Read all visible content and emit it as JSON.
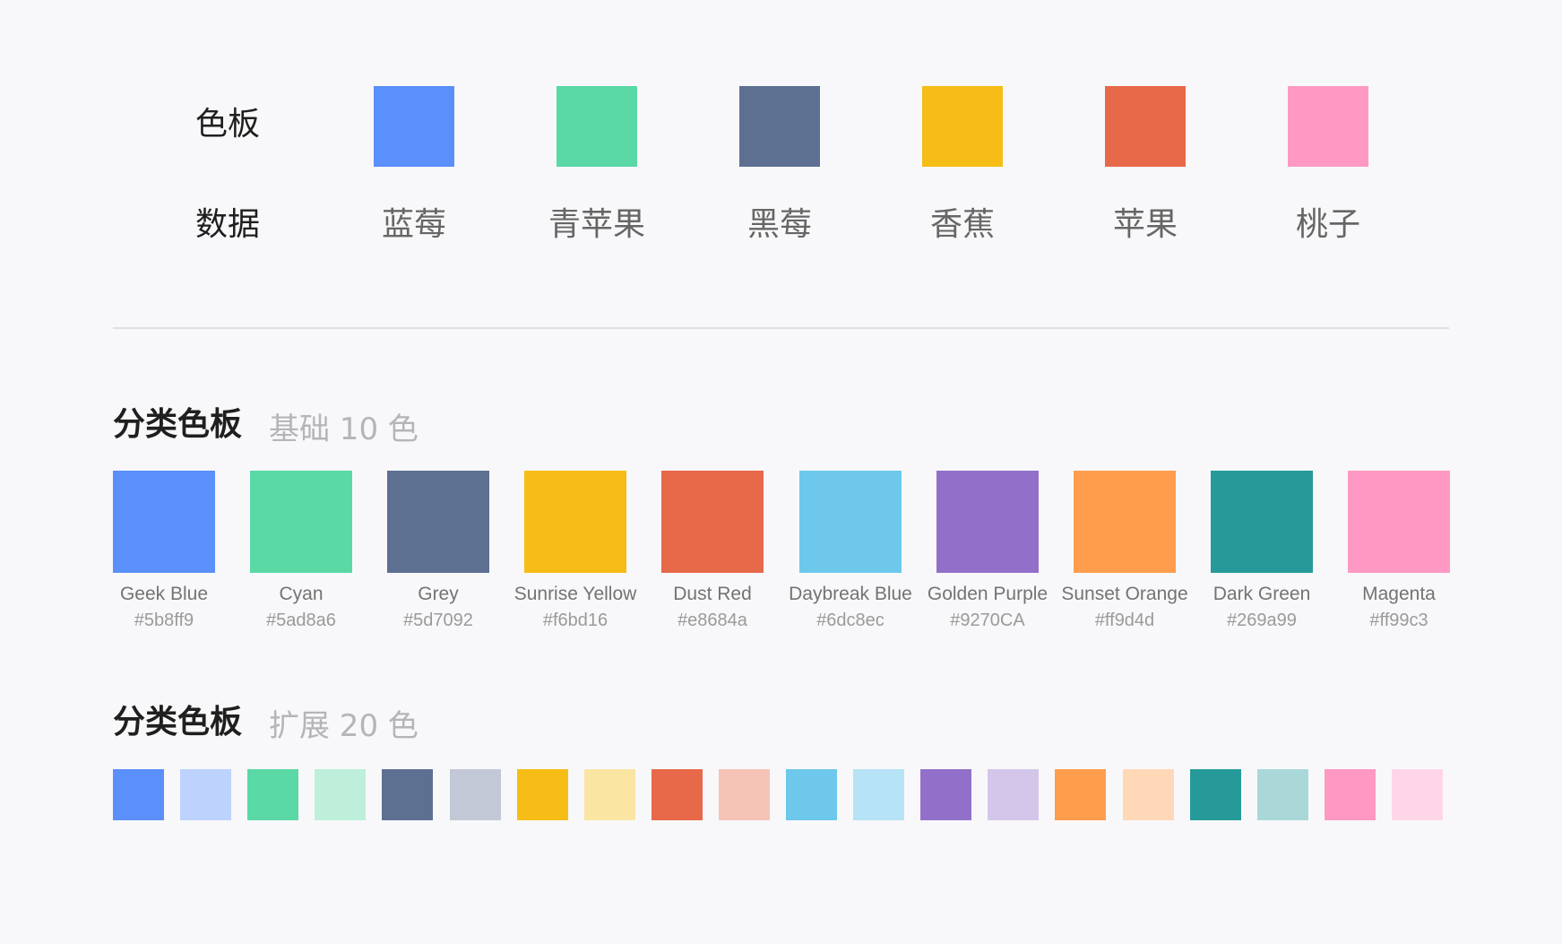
{
  "mapping": {
    "palette_label": "色板",
    "data_label": "数据",
    "items": [
      {
        "label": "蓝莓",
        "color": "#5b8ff9"
      },
      {
        "label": "青苹果",
        "color": "#5ad8a6"
      },
      {
        "label": "黑莓",
        "color": "#5d7092"
      },
      {
        "label": "香蕉",
        "color": "#f6bd16"
      },
      {
        "label": "苹果",
        "color": "#e8684a"
      },
      {
        "label": "桃子",
        "color": "#ff99c3"
      }
    ]
  },
  "base_palette": {
    "title": "分类色板",
    "subtitle": "基础 10 色",
    "colors": [
      {
        "name": "Geek Blue",
        "hex": "#5b8ff9"
      },
      {
        "name": "Cyan",
        "hex": "#5ad8a6"
      },
      {
        "name": "Grey",
        "hex": "#5d7092"
      },
      {
        "name": "Sunrise Yellow",
        "hex": "#f6bd16"
      },
      {
        "name": "Dust Red",
        "hex": "#e8684a"
      },
      {
        "name": "Daybreak Blue",
        "hex": "#6dc8ec"
      },
      {
        "name": "Golden Purple",
        "hex": "#9270CA"
      },
      {
        "name": "Sunset Orange",
        "hex": "#ff9d4d"
      },
      {
        "name": "Dark Green",
        "hex": "#269a99"
      },
      {
        "name": "Magenta",
        "hex": "#ff99c3"
      }
    ]
  },
  "extended_palette": {
    "title": "分类色板",
    "subtitle": "扩展 20 色",
    "colors": [
      "#5b8ff9",
      "#bdd2fd",
      "#5ad8a6",
      "#bdefdb",
      "#5d7092",
      "#c2c8d5",
      "#f6bd16",
      "#fbe5a2",
      "#e8684a",
      "#f6c3b7",
      "#6dc8ec",
      "#b6e3f5",
      "#9270ca",
      "#d3c6ea",
      "#ff9d4d",
      "#ffd8b8",
      "#269a99",
      "#aad8d8",
      "#ff99c3",
      "#ffd6e7"
    ]
  }
}
